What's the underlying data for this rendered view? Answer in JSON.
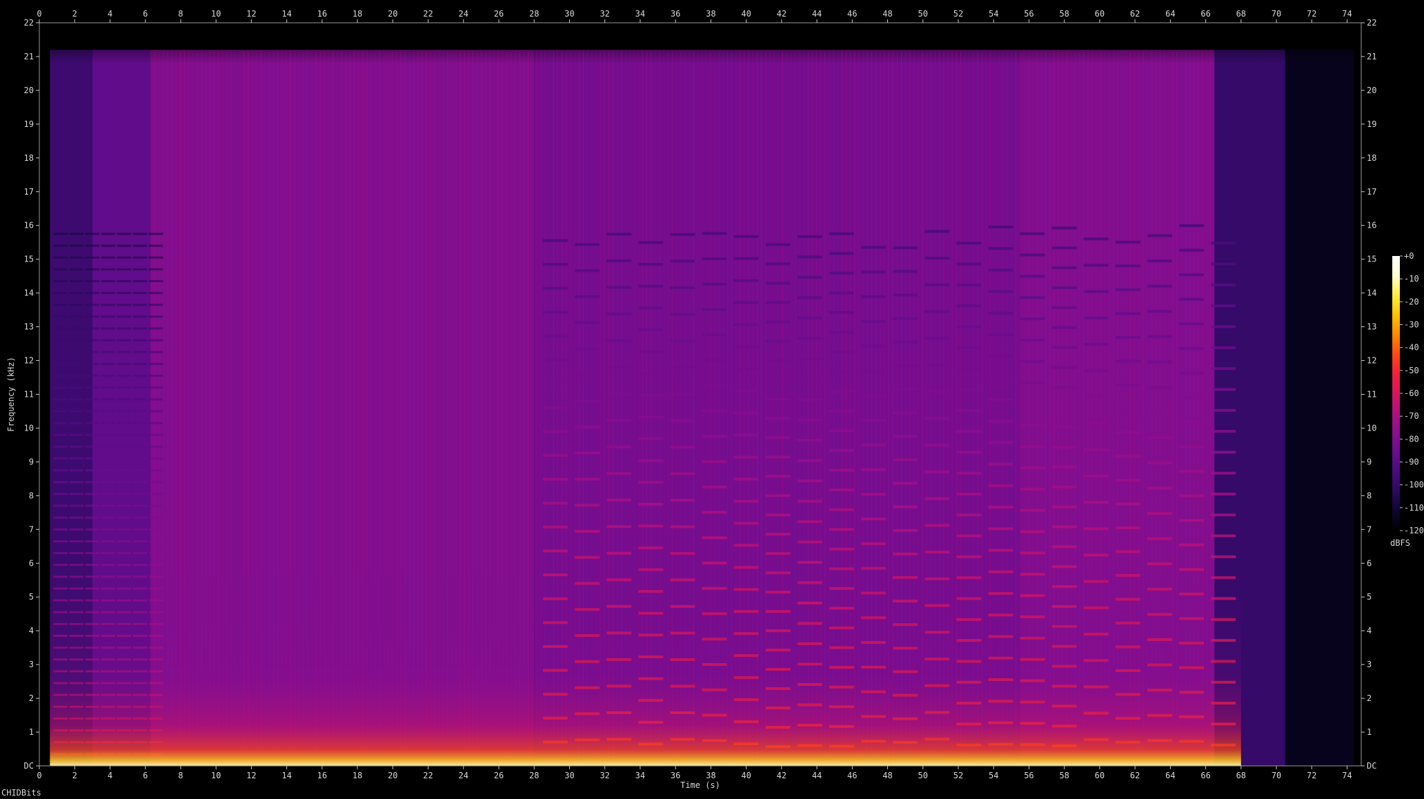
{
  "chart_data": {
    "type": "heatmap",
    "subtype": "spectrogram",
    "xlabel": "Time (s)",
    "ylabel": "Frequency (kHz)",
    "xlim": [
      0,
      74.8
    ],
    "ylim": [
      0,
      22
    ],
    "x_ticks": [
      0,
      2,
      4,
      6,
      8,
      10,
      12,
      14,
      16,
      18,
      20,
      22,
      24,
      26,
      28,
      30,
      32,
      34,
      36,
      38,
      40,
      42,
      44,
      46,
      48,
      50,
      52,
      54,
      56,
      58,
      60,
      62,
      64,
      66,
      68,
      70,
      72,
      74
    ],
    "x_tick_labels": [
      "0",
      "2",
      "4",
      "6",
      "8",
      "10",
      "12",
      "14",
      "16",
      "18",
      "20",
      "22",
      "24",
      "26",
      "28",
      "30",
      "32",
      "34",
      "36",
      "38",
      "40",
      "42",
      "44",
      "46",
      "48",
      "50",
      "52",
      "54",
      "56",
      "58",
      "60",
      "62",
      "64",
      "66",
      "68",
      "70",
      "72",
      "74"
    ],
    "y_ticks": [
      0,
      1,
      2,
      3,
      4,
      5,
      6,
      7,
      8,
      9,
      10,
      11,
      12,
      13,
      14,
      15,
      16,
      17,
      18,
      19,
      20,
      21,
      22
    ],
    "y_tick_labels": [
      "DC",
      "1",
      "2",
      "3",
      "4",
      "5",
      "6",
      "7",
      "8",
      "9",
      "10",
      "11",
      "12",
      "13",
      "14",
      "15",
      "16",
      "17",
      "18",
      "19",
      "20",
      "21",
      "22"
    ],
    "colorbar": {
      "label": "dBFS",
      "range": [
        -120,
        0
      ],
      "ticks": [
        0,
        -10,
        -20,
        -30,
        -40,
        -50,
        -60,
        -70,
        -80,
        -90,
        -100,
        -110,
        -120
      ],
      "tick_labels": [
        "+0",
        "-10",
        "-20",
        "-30",
        "-40",
        "-50",
        "-60",
        "-70",
        "-80",
        "-90",
        "-100",
        "-110",
        "-120"
      ],
      "colors": [
        "#000000",
        "#0d0630",
        "#2b0a5e",
        "#4a0b7e",
        "#6a0d8f",
        "#8c0e8f",
        "#b01080",
        "#d61660",
        "#f0203a",
        "#ff4a12",
        "#ff8a00",
        "#ffc200",
        "#ffee40",
        "#ffffd0",
        "#ffffff"
      ]
    },
    "signal_time_range_s": [
      0.6,
      74.4
    ],
    "dense_section_start_s": 6.3,
    "energy_segments": [
      {
        "start": 0.0,
        "end": 0.6,
        "level_db": -125
      },
      {
        "start": 0.6,
        "end": 3.0,
        "level_db": -98
      },
      {
        "start": 3.0,
        "end": 6.3,
        "level_db": -88
      },
      {
        "start": 6.3,
        "end": 28.0,
        "level_db": -80
      },
      {
        "start": 28.0,
        "end": 55.5,
        "level_db": -83
      },
      {
        "start": 55.5,
        "end": 66.5,
        "level_db": -80
      },
      {
        "start": 66.5,
        "end": 70.5,
        "level_db": -100
      },
      {
        "start": 70.5,
        "end": 74.4,
        "level_db": -115
      }
    ]
  },
  "watermark": "CHIDBits"
}
